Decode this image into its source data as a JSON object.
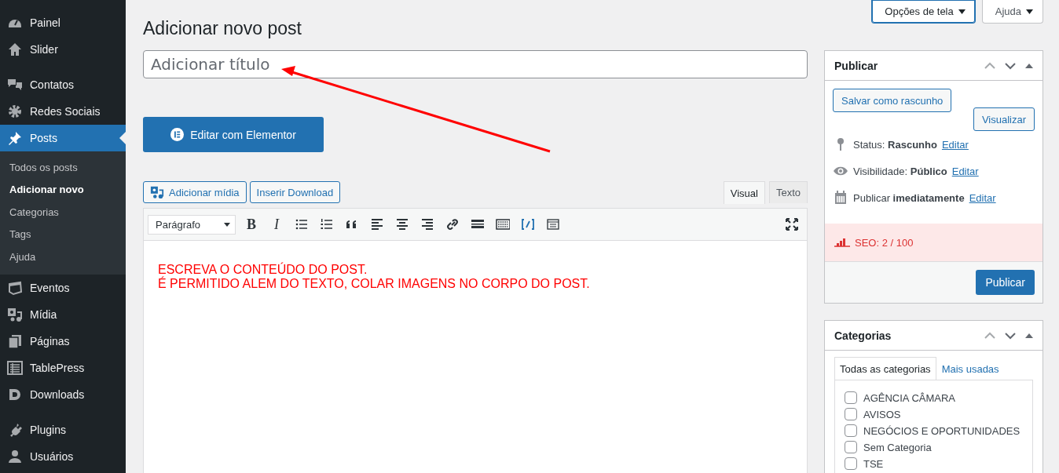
{
  "sidebar": {
    "groups": [
      {
        "items": [
          {
            "kind": "dashboard",
            "label": "Painel",
            "selected": false
          },
          {
            "kind": "home",
            "label": "Slider",
            "selected": false
          }
        ]
      },
      {
        "items": [
          {
            "kind": "chat",
            "label": "Contatos",
            "selected": false
          },
          {
            "kind": "gear",
            "label": "Redes Sociais",
            "selected": false
          },
          {
            "kind": "pin",
            "label": "Posts",
            "selected": true,
            "children": [
              {
                "label": "Todos os posts",
                "selected": false
              },
              {
                "label": "Adicionar novo",
                "selected": true
              },
              {
                "label": "Categorias",
                "selected": false
              },
              {
                "label": "Tags",
                "selected": false
              },
              {
                "label": "Ajuda",
                "selected": false
              }
            ]
          },
          {
            "kind": "calendar",
            "label": "Eventos",
            "selected": false
          },
          {
            "kind": "media",
            "label": "Mídia",
            "selected": false
          },
          {
            "kind": "pages",
            "label": "Páginas",
            "selected": false
          },
          {
            "kind": "table",
            "label": "TablePress",
            "selected": false
          },
          {
            "kind": "download",
            "label": "Downloads",
            "selected": false
          }
        ]
      },
      {
        "items": [
          {
            "kind": "plug",
            "label": "Plugins",
            "selected": false
          },
          {
            "kind": "user",
            "label": "Usuários",
            "selected": false
          }
        ]
      }
    ]
  },
  "screen_meta": [
    {
      "label": "Opções de tela",
      "selected": true
    },
    {
      "label": "Ajuda",
      "selected": false
    }
  ],
  "page_title": "Adicionar novo post",
  "title_field": {
    "placeholder": "Adicionar título"
  },
  "elementor_button": "Editar com Elementor",
  "media_buttons": [
    {
      "kind": "media",
      "label": "Adicionar mídia"
    },
    {
      "kind": "plain",
      "label": "Inserir Download"
    }
  ],
  "editor_tabs": [
    {
      "label": "Visual",
      "selected": true
    },
    {
      "label": "Texto",
      "selected": false
    }
  ],
  "toolbar": {
    "format": "Parágrafo",
    "bold": "B",
    "italic": "I"
  },
  "content_lines": [
    "ESCREVA O CONTEÚDO DO POST.",
    "É PERMITIDO ALEM DO TEXTO, COLAR IMAGENS NO CORPO DO POST."
  ],
  "publish_box": {
    "title": "Publicar",
    "save_draft": "Salvar como rascunho",
    "preview": "Visualizar",
    "rows": [
      {
        "kind": "status",
        "text": "Status: **Rascunho**",
        "link": "Editar"
      },
      {
        "kind": "visibility",
        "text": "Visibilidade: **Público**",
        "link": "Editar"
      },
      {
        "kind": "schedule",
        "text": "Publicar **imediatamente**",
        "link": "Editar"
      }
    ],
    "seo": "SEO: 2 / 100",
    "publish": "Publicar"
  },
  "categories_box": {
    "title": "Categorias",
    "tabs": [
      {
        "label": "Todas as categorias",
        "selected": true
      },
      {
        "label": "Mais usadas",
        "selected": false
      }
    ],
    "items": [
      {
        "label": "AGÊNCIA CÂMARA",
        "checked": false
      },
      {
        "label": "AVISOS",
        "checked": false
      },
      {
        "label": "NEGÓCIOS E OPORTUNIDADES",
        "checked": false
      },
      {
        "label": "Sem Categoria",
        "checked": false
      },
      {
        "label": "TSE",
        "checked": false
      }
    ]
  }
}
